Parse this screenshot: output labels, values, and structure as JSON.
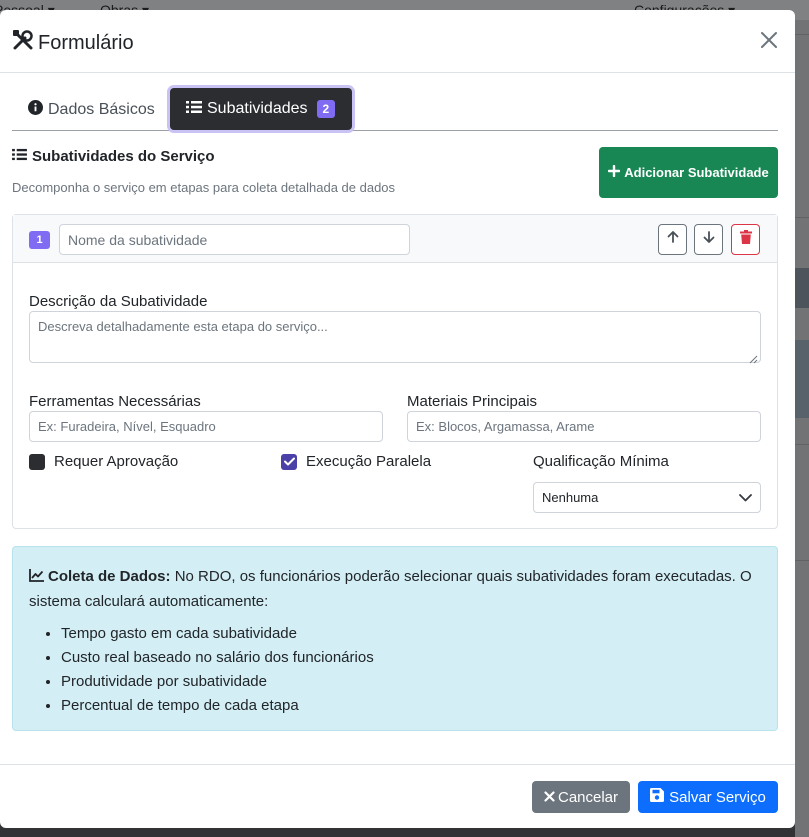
{
  "background_nav": {
    "items": [
      "Pessoal ▾",
      "Obras ▾",
      "Configurações ▾"
    ]
  },
  "modal": {
    "title": "Formulário",
    "close_icon": "close-icon"
  },
  "tabs": [
    {
      "label": "Dados Básicos",
      "icon": "info-circle-icon",
      "active": false
    },
    {
      "label": "Subatividades",
      "icon": "list-icon",
      "badge": "2",
      "active": true
    }
  ],
  "section": {
    "title": "Subatividades do Serviço",
    "subtitle": "Decomponha o serviço em etapas para coleta detalhada de dados",
    "add_button": "Adicionar Subatividade"
  },
  "subactivity": {
    "number": "1",
    "name_value": "",
    "name_placeholder": "Nome da subatividade",
    "description_label": "Descrição da Subatividade",
    "description_placeholder": "Descreva detalhadamente esta etapa do serviço...",
    "tools_label": "Ferramentas Necessárias",
    "tools_placeholder": "Ex: Furadeira, Nível, Esquadro",
    "materials_label": "Materiais Principais",
    "materials_placeholder": "Ex: Blocos, Argamassa, Arame",
    "requires_approval_label": "Requer Aprovação",
    "requires_approval_checked": false,
    "parallel_label": "Execução Paralela",
    "parallel_checked": true,
    "qualification_label": "Qualificação Mínima",
    "qualification_value": "Nenhuma"
  },
  "info": {
    "heading": "Coleta de Dados:",
    "text": " No RDO, os funcionários poderão selecionar quais subatividades foram executadas. O sistema calculará automaticamente:",
    "items": [
      "Tempo gasto em cada subatividade",
      "Custo real baseado no salário dos funcionários",
      "Produtividade por subatividade",
      "Percentual de tempo de cada etapa"
    ]
  },
  "footer": {
    "cancel": "Cancelar",
    "save": "Salvar Serviço"
  },
  "colors": {
    "accent_purple": "#7f6cf2",
    "success": "#198754",
    "primary": "#0d6efd",
    "info_bg": "#d3eff5"
  }
}
